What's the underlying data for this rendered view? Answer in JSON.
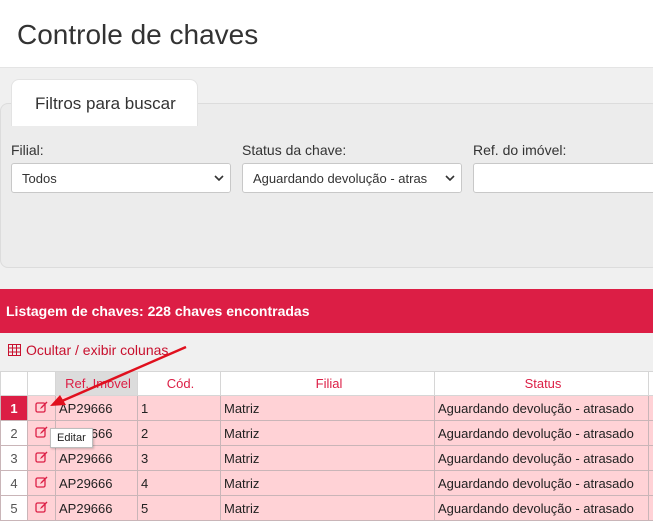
{
  "header": {
    "title": "Controle de chaves"
  },
  "filters": {
    "tab_label": "Filtros para buscar",
    "branch": {
      "label": "Filial:",
      "value": "Todos"
    },
    "status": {
      "label": "Status da chave:",
      "value": "Aguardando devolução - atras"
    },
    "ref": {
      "label": "Ref. do imóvel:",
      "value": ""
    }
  },
  "listing": {
    "header": "Listagem de chaves: 228 chaves encontradas",
    "toggle_columns": "Ocultar / exibir colunas",
    "columns": [
      "Ref. Imóvel",
      "Cód.",
      "Filial",
      "Status"
    ],
    "rows": [
      {
        "num": "1",
        "ref": "AP29666",
        "cod": "1",
        "filial": "Matriz",
        "status": "Aguardando devolução - atrasado"
      },
      {
        "num": "2",
        "ref": "AP29666",
        "cod": "2",
        "filial": "Matriz",
        "status": "Aguardando devolução - atrasado"
      },
      {
        "num": "3",
        "ref": "AP29666",
        "cod": "3",
        "filial": "Matriz",
        "status": "Aguardando devolução - atrasado"
      },
      {
        "num": "4",
        "ref": "AP29666",
        "cod": "4",
        "filial": "Matriz",
        "status": "Aguardando devolução - atrasado"
      },
      {
        "num": "5",
        "ref": "AP29666",
        "cod": "5",
        "filial": "Matriz",
        "status": "Aguardando devolução - atrasado"
      }
    ]
  },
  "tooltip": {
    "text": "Editar"
  },
  "colors": {
    "accent": "#dc1e45",
    "row_bg": "#ffd2d6",
    "link": "#c8102e"
  }
}
